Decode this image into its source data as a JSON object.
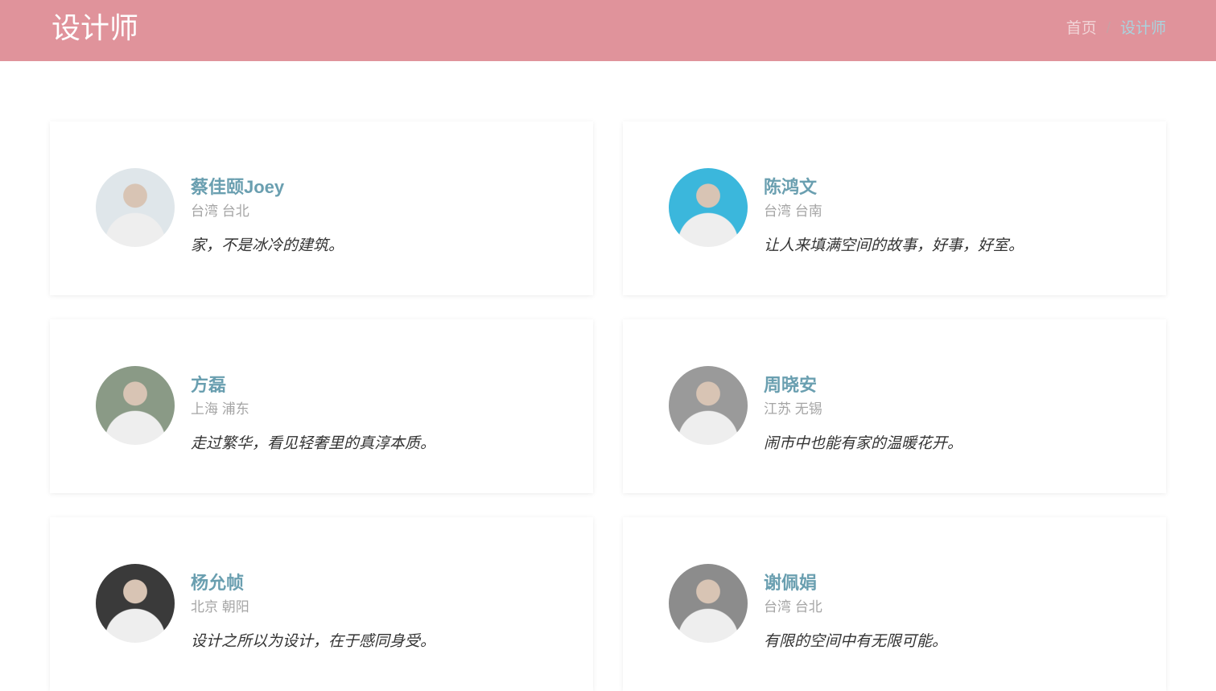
{
  "header": {
    "title": "设计师",
    "breadcrumb": [
      {
        "label": "首页"
      },
      {
        "label": "/"
      },
      {
        "label": "设计师"
      }
    ]
  },
  "designers": [
    {
      "name": "蔡佳颐Joey",
      "location": "台湾 台北",
      "quote": "家，不是冰冷的建筑。",
      "avatar_bg": "#dfe6ea"
    },
    {
      "name": "陈鸿文",
      "location": "台湾 台南",
      "quote": "让人来填满空间的故事，好事，好室。",
      "avatar_bg": "#3bb7dc"
    },
    {
      "name": "方磊",
      "location": "上海 浦东",
      "quote": "走过繁华，看见轻奢里的真淳本质。",
      "avatar_bg": "#8a9a86"
    },
    {
      "name": "周晓安",
      "location": "江苏 无锡",
      "quote": "闹市中也能有家的温暖花开。",
      "avatar_bg": "#9a9a9a"
    },
    {
      "name": "杨允帧",
      "location": "北京 朝阳",
      "quote": "设计之所以为设计，在于感同身受。",
      "avatar_bg": "#3a3a3a"
    },
    {
      "name": "谢佩娟",
      "location": "台湾 台北",
      "quote": "有限的空间中有无限可能。",
      "avatar_bg": "#8c8c8c"
    }
  ]
}
